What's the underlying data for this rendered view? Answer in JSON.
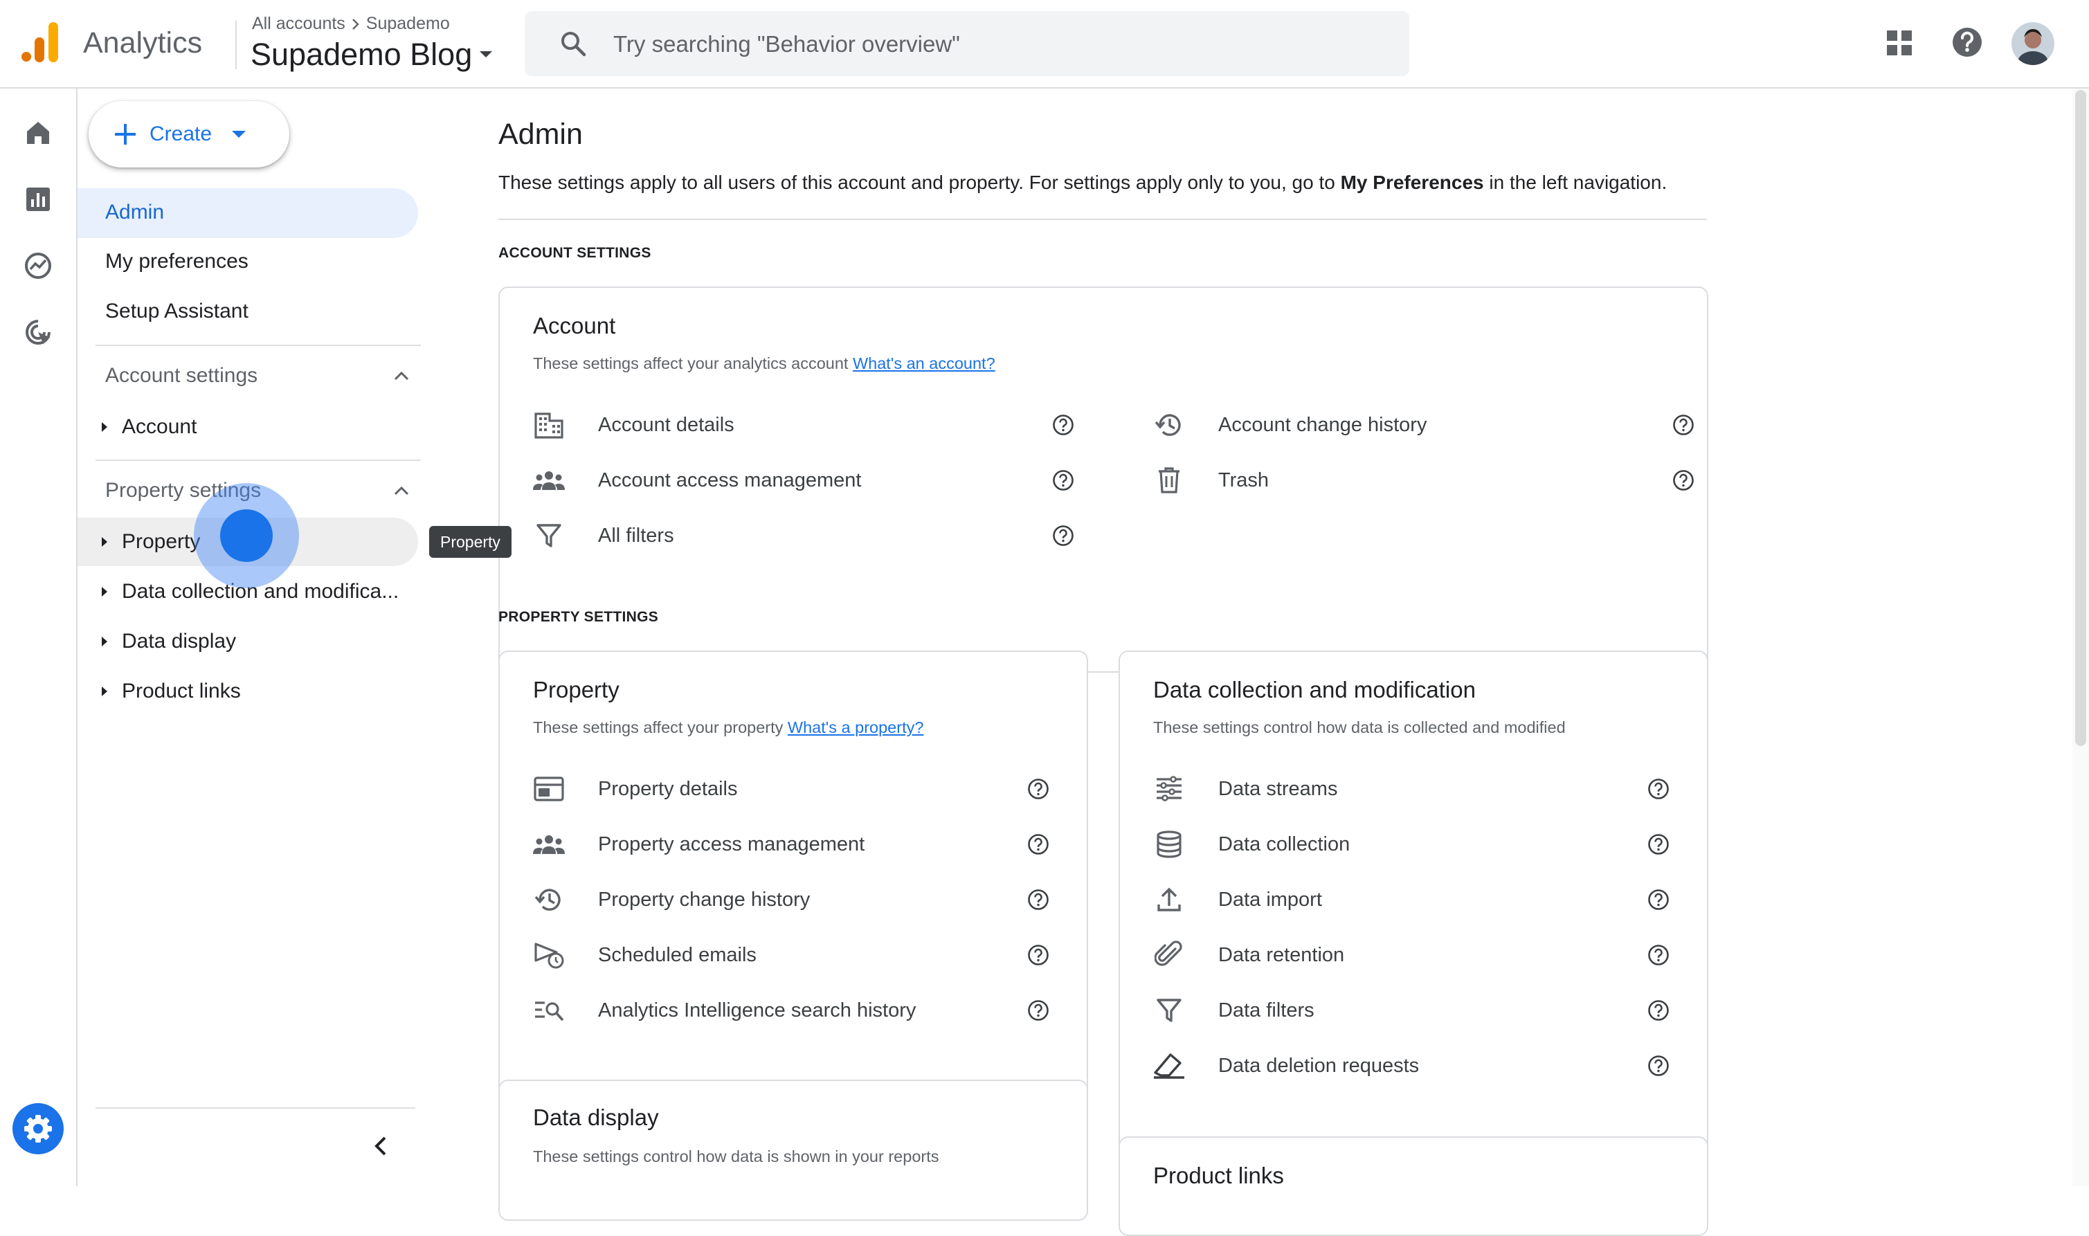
{
  "app": {
    "product_name": "Analytics",
    "breadcrumb": [
      "All accounts",
      "Supademo"
    ],
    "property_name": "Supademo Blog",
    "search_placeholder": "Try searching \"Behavior overview\""
  },
  "colors": {
    "accent": "#1a73e8",
    "logo_orange": "#f9ab00",
    "logo_dark_orange": "#e37400",
    "nav_selected_bg": "#e8f0fe",
    "settings_fab": "#1a73e8"
  },
  "rail": {
    "icons": [
      "home-icon",
      "reports-icon",
      "explore-icon",
      "advertising-icon"
    ],
    "bottom_icon": "admin-gear-icon"
  },
  "sidepanel": {
    "create_label": "Create",
    "nav": {
      "admin": "Admin",
      "my_preferences": "My preferences",
      "setup_assistant": "Setup Assistant"
    },
    "account_settings": {
      "label": "Account settings",
      "items": [
        "Account"
      ]
    },
    "property_settings": {
      "label": "Property settings",
      "items": [
        "Property",
        "Data collection and modifica...",
        "Data display",
        "Product links"
      ]
    }
  },
  "tooltip": "Property",
  "main": {
    "title": "Admin",
    "desc_before": "These settings apply to all users of this account and property. For settings apply only to you, go to ",
    "desc_bold": "My Preferences",
    "desc_after": " in the left navigation.",
    "account_settings_label": "ACCOUNT SETTINGS",
    "property_settings_label": "PROPERTY SETTINGS",
    "account_card": {
      "title": "Account",
      "desc": "These settings affect your analytics account ",
      "link": "What's an account?",
      "left_items": [
        "Account details",
        "Account access management",
        "All filters"
      ],
      "right_items": [
        "Account change history",
        "Trash"
      ]
    },
    "property_card": {
      "title": "Property",
      "desc": "These settings affect your property ",
      "link": "What's a property?",
      "items": [
        "Property details",
        "Property access management",
        "Property change history",
        "Scheduled emails",
        "Analytics Intelligence search history"
      ]
    },
    "data_collection_card": {
      "title": "Data collection and modification",
      "desc": "These settings control how data is collected and modified",
      "items": [
        "Data streams",
        "Data collection",
        "Data import",
        "Data retention",
        "Data filters",
        "Data deletion requests"
      ]
    },
    "data_display_card": {
      "title": "Data display",
      "desc": "These settings control how data is shown in your reports"
    },
    "product_links_card": {
      "title": "Product links"
    }
  }
}
